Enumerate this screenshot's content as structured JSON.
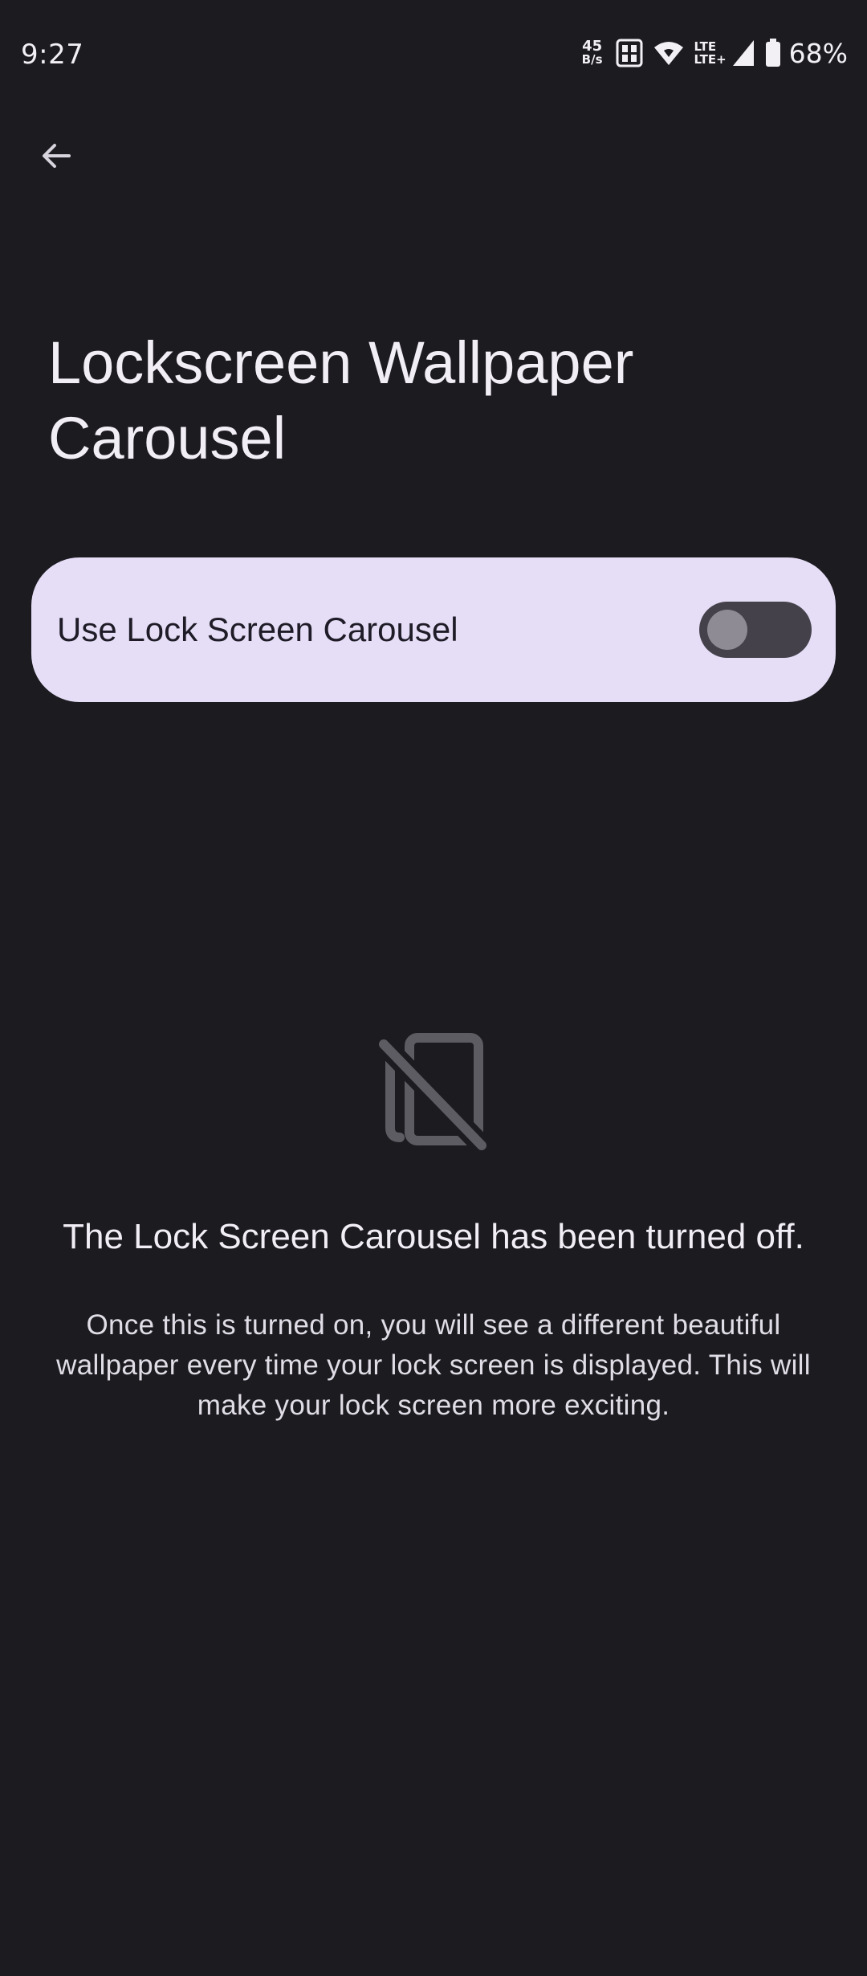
{
  "status_bar": {
    "time": "9:27",
    "net_speed_value": "45",
    "net_speed_unit": "B/s",
    "lte_top": "LTE",
    "lte_bottom": "LTE+",
    "battery": "68%"
  },
  "header": {
    "back_icon": "arrow-left-icon"
  },
  "page": {
    "title": "Lockscreen Wallpaper Carousel"
  },
  "toggle": {
    "label": "Use Lock Screen Carousel",
    "checked": false
  },
  "empty_state": {
    "icon": "wallpaper-off-icon",
    "title": "The Lock Screen Carousel has been turned off.",
    "description": "Once this is turned on, you will see a different beautiful wallpaper every time your lock screen is displayed. This will make your lock screen more exciting."
  },
  "colors": {
    "background": "#1c1b20",
    "card": "#e6def7",
    "switch_track": "#44414a",
    "switch_knob": "#8e8b94"
  }
}
